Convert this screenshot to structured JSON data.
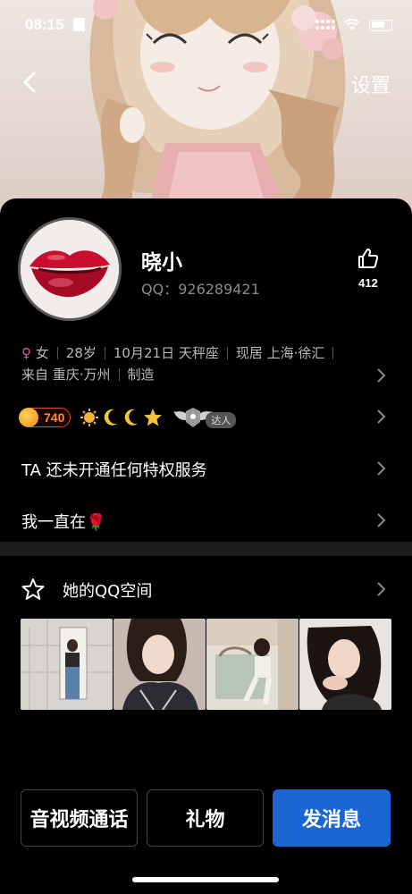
{
  "status_bar": {
    "time": "08:15"
  },
  "nav": {
    "settings_label": "设置"
  },
  "profile": {
    "nickname": "晓小",
    "qq_label": "QQ：",
    "qq_number": "926289421",
    "like_count": "412"
  },
  "info": {
    "gender": "女",
    "age": "28岁",
    "birthday_sign": "10月21日 天秤座",
    "residence": "现居 上海·徐汇",
    "hometown": "来自 重庆·万州",
    "occupation": "制造"
  },
  "badges": {
    "level": "740",
    "daren_label": "达人"
  },
  "menu": {
    "privilege": "TA 还未开通任何特权服务",
    "signature": "我一直在🌹"
  },
  "qzone": {
    "title": "她的QQ空间"
  },
  "actions": {
    "call_label": "音视频通话",
    "gift_label": "礼物",
    "message_label": "发消息"
  },
  "colors": {
    "primary_button": "#1a66d2",
    "female_symbol": "#e05aa0",
    "level_pill": "#e04a26",
    "card_background": "#000000"
  }
}
